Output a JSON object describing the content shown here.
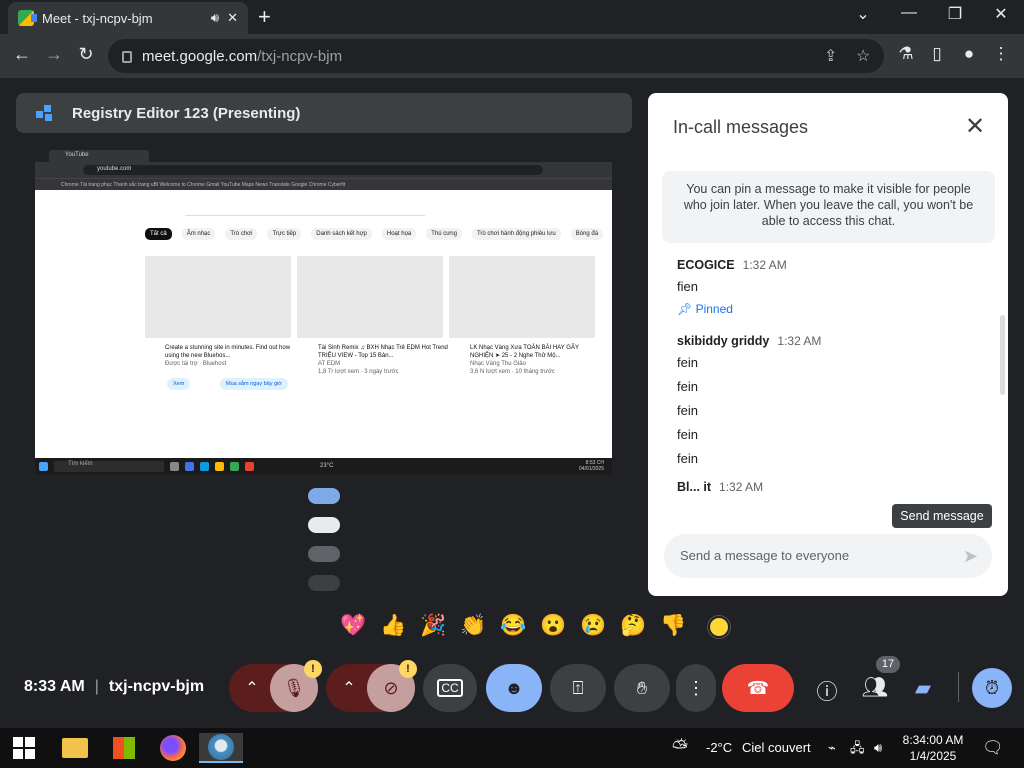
{
  "browser": {
    "tab_title": "Meet - txj-ncpv-bjm",
    "url_host": "meet.google.com",
    "url_path": "/txj-ncpv-bjm"
  },
  "presenting": {
    "title": "Registry Editor 123 (Presenting)"
  },
  "shared_screen": {
    "tab_title": "YouTube",
    "address": "youtube.com",
    "bookmarks": "Chrome   Tài trang phục   Thanh sắc trang   uBl   Welcome to Chrome   Gmail   YouTube   Maps   News   Translate   Google Chrome   Cyberfit",
    "chips": [
      "Tất cả",
      "Âm nhạc",
      "Trò chơi",
      "Trực tiếp",
      "Danh sách kết hợp",
      "Hoạt họa",
      "Thú cưng",
      "Trò chơi hành động phiêu lưu",
      "Bóng đá"
    ],
    "cards": [
      {
        "title": "Create a stunning site in minutes. Find out how using the new Bluehos...",
        "sub": "Được tài trợ · Bluehost",
        "btn1": "Xem",
        "btn2": "Mua sắm ngay bây giờ"
      },
      {
        "title": "Tái Sinh Remix ♫ BXH Nhạc Trẻ EDM Hot Trend TRIỆU VIEW - Top 15 Bản...",
        "sub": "AT EDM",
        "sub2": "1,8 Tr lượt xem · 3 ngày trước"
      },
      {
        "title": "LK Nhạc Vàng Xưa TOÀN BÀI HAY GÂY NGHIỆN ➤ 25 - 2 Nghe Thử Mộ...",
        "sub": "Nhạc Vàng Thu Giảo",
        "sub2": "3,6 N lượt xem · 10 tháng trước"
      }
    ],
    "taskbar_search": "Tìm kiếm",
    "taskbar_temp": "23°C",
    "taskbar_time": "8:53 CH",
    "taskbar_date": "04/01/2025"
  },
  "chat": {
    "title": "In-call messages",
    "pin_info": "You can pin a message to make it visible for people who join later. When you leave the call, you won't be able to access this chat.",
    "messages": [
      {
        "sender": "ECOGICE",
        "time": "1:32 AM",
        "lines": [
          "fien"
        ],
        "pinned": "Pinned"
      },
      {
        "sender": "skibiddy griddy",
        "time": "1:32 AM",
        "lines": [
          "fein",
          "fein",
          "fein",
          "fein",
          "fein"
        ]
      }
    ],
    "partial_sender": "Bl... it",
    "partial_time": "1:32 AM",
    "tooltip": "Send message",
    "input_placeholder": "Send a message to everyone"
  },
  "reactions": [
    "💖",
    "👍",
    "🎉",
    "👏",
    "😂",
    "😮",
    "😢",
    "🤔",
    "👎"
  ],
  "controls": {
    "time": "8:33 AM",
    "meeting_code": "txj-ncpv-bjm",
    "participants_count": "17",
    "warn": "!"
  },
  "taskbar": {
    "weather_temp": "-2°C",
    "weather_text": "Ciel couvert",
    "time": "8:34:00 AM",
    "date": "1/4/2025"
  },
  "colors": {
    "meet_bg": "#202124",
    "leave_red": "#ea4335",
    "active_blue": "#8ab4f8",
    "warning_yellow": "#fdd663"
  }
}
